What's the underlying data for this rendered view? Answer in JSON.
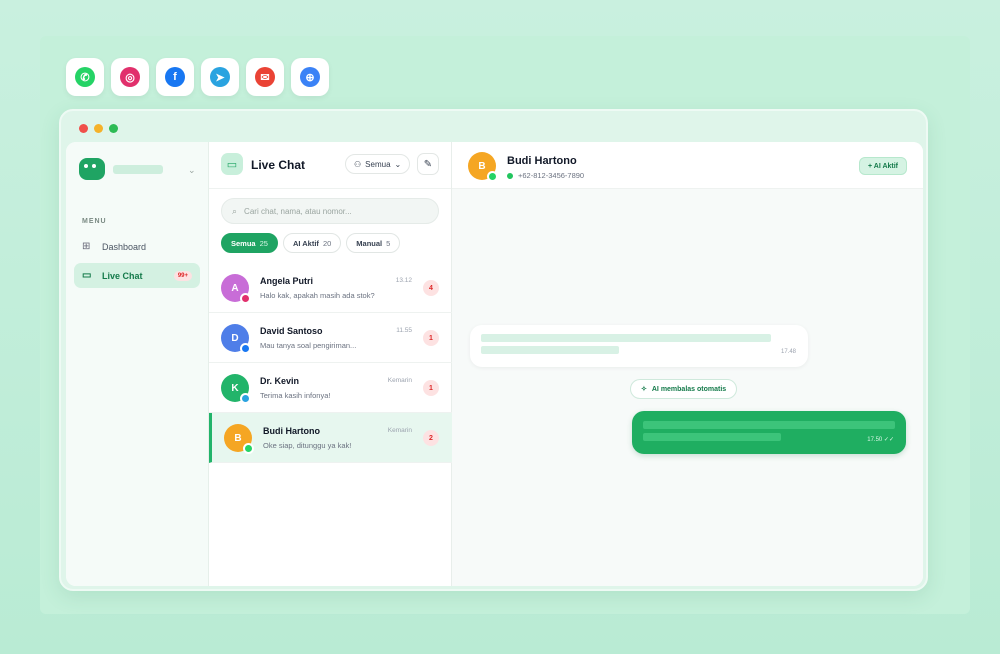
{
  "channels": [
    {
      "icon": "whatsapp-icon",
      "color": "#25d366",
      "glyph": "✆"
    },
    {
      "icon": "instagram-icon",
      "color": "#e1306c",
      "glyph": "◎"
    },
    {
      "icon": "facebook-icon",
      "color": "#1877f2",
      "glyph": "f"
    },
    {
      "icon": "telegram-icon",
      "color": "#2aa3e0",
      "glyph": "➤"
    },
    {
      "icon": "email-icon",
      "color": "#ea4335",
      "glyph": "✉"
    },
    {
      "icon": "web-icon",
      "color": "#3b82f6",
      "glyph": "⊕"
    }
  ],
  "sidebar": {
    "menu_label": "MENU",
    "items": [
      {
        "label": "Dashboard",
        "icon": "grid-icon"
      },
      {
        "label": "Live Chat",
        "icon": "chat-icon",
        "badge": "99+"
      }
    ]
  },
  "chatlist": {
    "title": "Live Chat",
    "filter_label": "Semua",
    "search_placeholder": "Cari chat, nama, atau nomor...",
    "tabs": [
      {
        "label": "Semua",
        "count": "25"
      },
      {
        "label": "AI Aktif",
        "count": "20"
      },
      {
        "label": "Manual",
        "count": "5"
      }
    ],
    "rows": [
      {
        "initial": "A",
        "name": "Angela Putri",
        "message": "Halo kak, apakah masih ada stok?",
        "time": "13.12",
        "badge": "4",
        "avatar_color": "#c86dd7",
        "channel_color": "#e1306c"
      },
      {
        "initial": "D",
        "name": "David Santoso",
        "message": "Mau tanya soal pengiriman...",
        "time": "11.55",
        "badge": "1",
        "avatar_color": "#4f7ee8",
        "channel_color": "#1877f2"
      },
      {
        "initial": "K",
        "name": "Dr. Kevin",
        "message": "Terima kasih infonya!",
        "time": "Kemarin",
        "badge": "1",
        "avatar_color": "#22b46a",
        "channel_color": "#2aa3e0"
      },
      {
        "initial": "B",
        "name": "Budi Hartono",
        "message": "Oke siap, ditunggu ya kak!",
        "time": "Kemarin",
        "badge": "2",
        "avatar_color": "#f5a623",
        "channel_color": "#25d366"
      }
    ]
  },
  "conversation": {
    "initial": "B",
    "name": "Budi Hartono",
    "phone": "+62-812-3456-7890",
    "ai_button": "+ AI Aktif",
    "incoming_time": "17.48",
    "ai_note": "AI membalas otomatis",
    "outgoing_time": "17.50 ✓✓"
  }
}
